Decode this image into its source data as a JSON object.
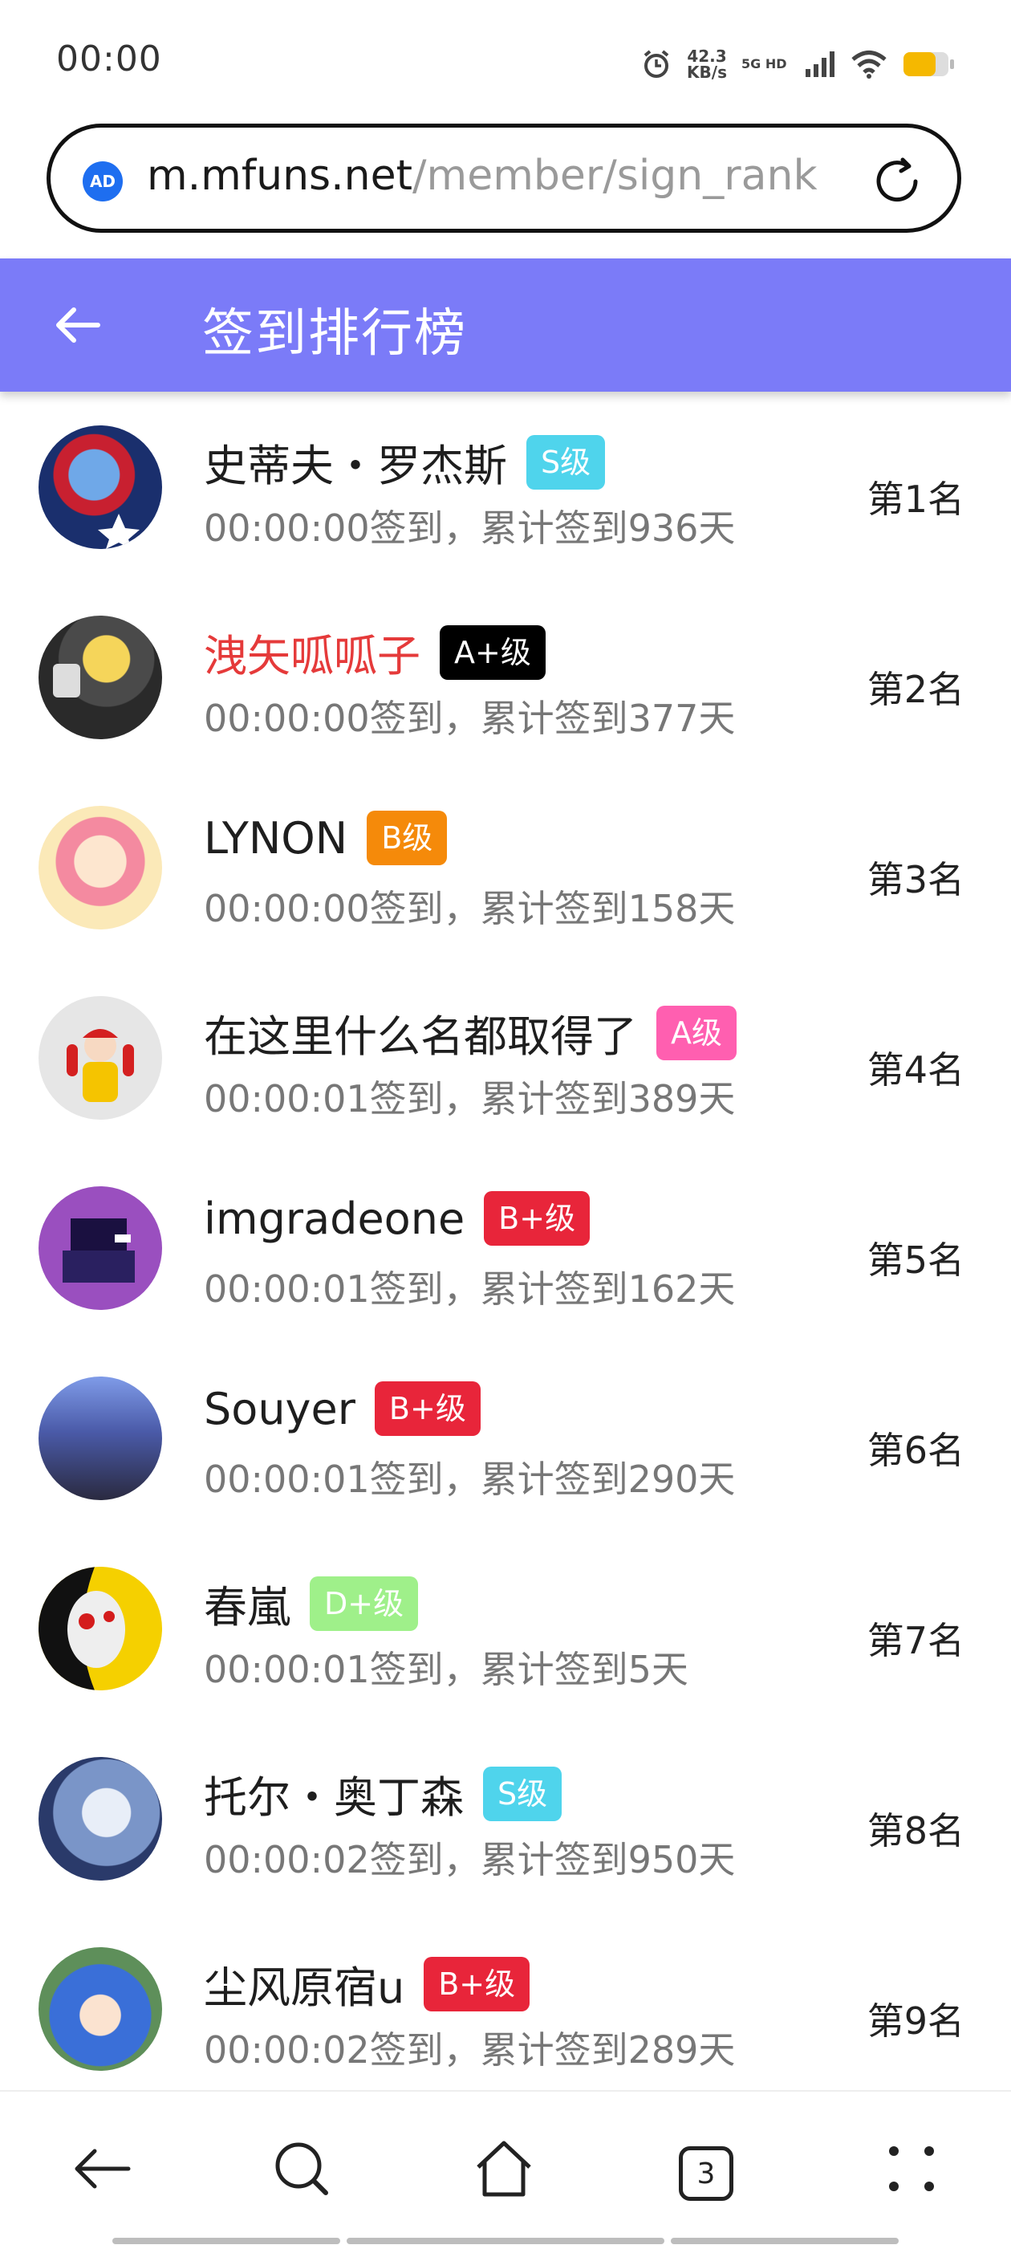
{
  "status_bar": {
    "time": "00:00",
    "speed_value": "42.3",
    "speed_unit": "KB/s",
    "network": "5G HD"
  },
  "url_bar": {
    "ad_label": "AD",
    "host": "m.mfuns.net",
    "path": "/member/sign_rank"
  },
  "header": {
    "title": "签到排行榜"
  },
  "ranking": [
    {
      "name": "史蒂夫・罗杰斯",
      "name_color": "#1e1e1e",
      "level": "S级",
      "level_color": "#4fd4ec",
      "meta": "00:00:00签到，累计签到936天",
      "rank": "第1名",
      "avatar": "captain-america-avatar"
    },
    {
      "name": "洩矢呱呱子",
      "name_color": "#e53a3a",
      "level": "A+级",
      "level_color": "#000000",
      "meta": "00:00:00签到，累计签到377天",
      "rank": "第2名",
      "avatar": "figure-avatar"
    },
    {
      "name": "LYNON",
      "name_color": "#1e1e1e",
      "level": "B级",
      "level_color": "#f58a0a",
      "meta": "00:00:00签到，累计签到158天",
      "rank": "第3名",
      "avatar": "anime-girl-avatar"
    },
    {
      "name": "在这里什么名都取得了",
      "name_color": "#1e1e1e",
      "level": "A级",
      "level_color": "#ff5fb0",
      "meta": "00:00:01签到，累计签到389天",
      "rank": "第4名",
      "avatar": "clown-avatar"
    },
    {
      "name": "imgradeone",
      "name_color": "#1e1e1e",
      "level": "B+级",
      "level_color": "#e8253a",
      "meta": "00:00:01签到，累计签到162天",
      "rank": "第5名",
      "avatar": "pixel-avatar"
    },
    {
      "name": "Souyer",
      "name_color": "#1e1e1e",
      "level": "B+级",
      "level_color": "#e8253a",
      "meta": "00:00:01签到，累计签到290天",
      "rank": "第6名",
      "avatar": "group-avatar"
    },
    {
      "name": "春嵐",
      "name_color": "#1e1e1e",
      "level": "D+级",
      "level_color": "#9ff08a",
      "meta": "00:00:01签到，累计签到5天",
      "rank": "第7名",
      "avatar": "mask-avatar"
    },
    {
      "name": "托尔・奥丁森",
      "name_color": "#1e1e1e",
      "level": "S级",
      "level_color": "#4fd4ec",
      "meta": "00:00:02签到，累计签到950天",
      "rank": "第8名",
      "avatar": "armor-avatar"
    },
    {
      "name": "尘风原宿u",
      "name_color": "#1e1e1e",
      "level": "B+级",
      "level_color": "#e8253a",
      "meta": "00:00:02签到，累计签到289天",
      "rank": "第9名",
      "avatar": "blue-hair-avatar"
    }
  ],
  "bottom_nav": {
    "tab_count": "3"
  }
}
